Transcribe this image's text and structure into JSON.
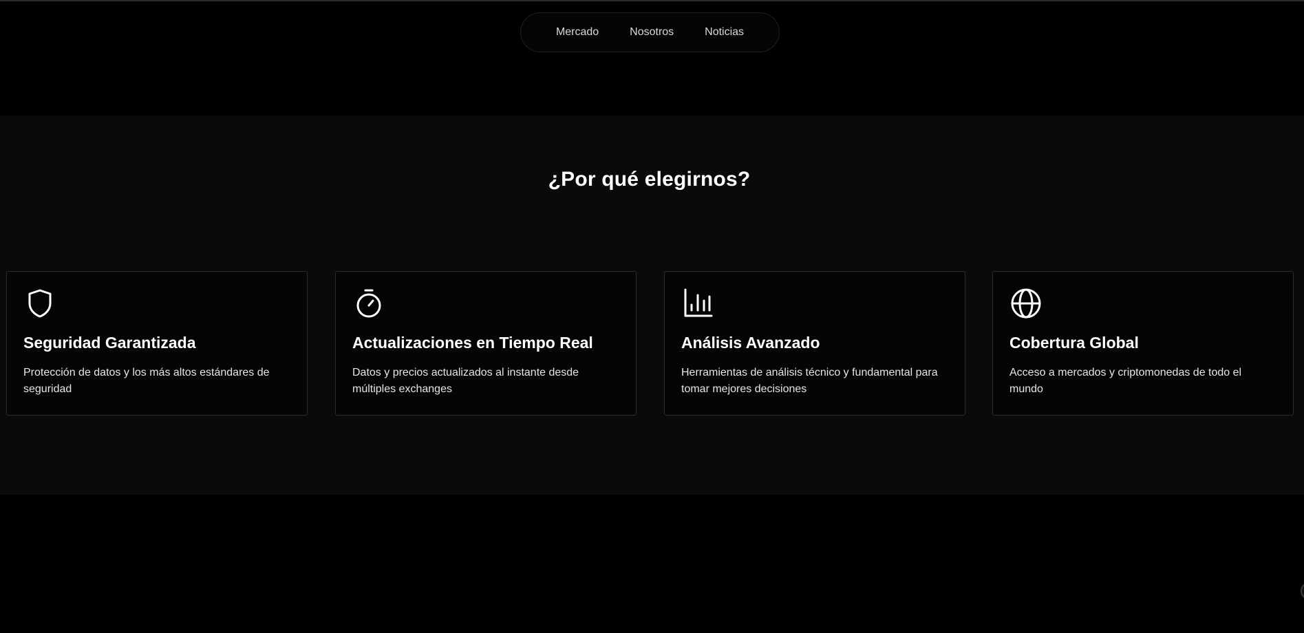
{
  "nav": {
    "items": [
      {
        "label": "Mercado"
      },
      {
        "label": "Nosotros"
      },
      {
        "label": "Noticias"
      }
    ]
  },
  "features": {
    "title": "¿Por qué elegirnos?",
    "cards": [
      {
        "icon": "shield-icon",
        "title": "Seguridad Garantizada",
        "description": "Protección de datos y los más altos estándares de seguridad"
      },
      {
        "icon": "stopwatch-icon",
        "title": "Actualizaciones en Tiempo Real",
        "description": "Datos y precios actualizados al instante desde múltiples exchanges"
      },
      {
        "icon": "bar-chart-icon",
        "title": "Análisis Avanzado",
        "description": "Herramientas de análisis técnico y fundamental para tomar mejores decisiones"
      },
      {
        "icon": "globe-icon",
        "title": "Cobertura Global",
        "description": "Acceso a mercados y criptomonedas de todo el mundo"
      }
    ]
  },
  "colors": {
    "page_background": "#000000",
    "section_background": "#0a0a0a",
    "card_border": "#2c2c2c",
    "text": "#ffffff"
  }
}
